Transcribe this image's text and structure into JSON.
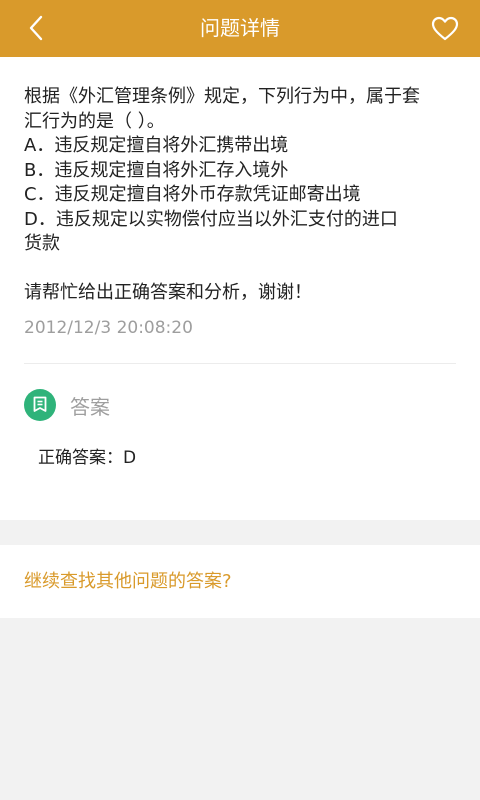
{
  "header": {
    "title": "问题详情",
    "back_icon": "chevron-left-icon",
    "favorite_icon": "heart-icon",
    "color": "#d99a2b"
  },
  "question": {
    "lines": [
      "根据《外汇管理条例》规定，下列行为中，属于套",
      "汇行为的是（ ）。",
      "A．违反规定擅自将外汇携带出境",
      "B．违反规定擅自将外汇存入境外",
      "C．违反规定擅自将外币存款凭证邮寄出境",
      "D．违反规定以实物偿付应当以外汇支付的进口",
      "货款",
      "",
      "请帮忙给出正确答案和分析，谢谢！"
    ],
    "timestamp": "2012/12/3 20:08:20"
  },
  "answer": {
    "heading": "答案",
    "icon": "answer-icon",
    "icon_color": "#2fb37a",
    "text": "正确答案：D"
  },
  "footer": {
    "more_link": "继续查找其他问题的答案?"
  }
}
